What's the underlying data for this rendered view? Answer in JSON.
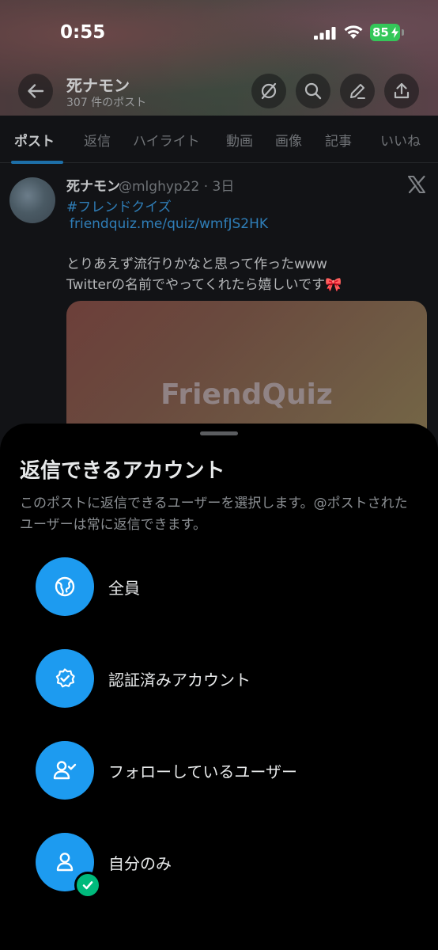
{
  "status": {
    "time": "0:55",
    "battery": "85"
  },
  "header": {
    "name": "死ナモン",
    "post_count": "307 件のポスト"
  },
  "tabs": [
    "ポスト",
    "返信",
    "ハイライト",
    "動画",
    "画像",
    "記事",
    "いいね"
  ],
  "post": {
    "name": "死ナモン",
    "handle": "@mlghyp22 · 3日",
    "hashtag": "#フレンドクイズ",
    "link": "friendquiz.me/quiz/wmfJS2HK",
    "text_line1": "とりあえず流行りかなと思って作ったwww",
    "text_line2": "Twitterの名前でやってくれたら嬉しいです🎀",
    "card_title": "FriendQuiz"
  },
  "sheet": {
    "title": "返信できるアカウント",
    "description": "このポストに返信できるユーザーを選択します。@ポストされたユーザーは常に返信できます。",
    "options": [
      {
        "label": "全員",
        "icon": "globe-icon"
      },
      {
        "label": "認証済みアカウント",
        "icon": "verified-badge-icon"
      },
      {
        "label": "フォローしているユーザー",
        "icon": "person-check-icon"
      },
      {
        "label": "自分のみ",
        "icon": "person-icon",
        "selected": true
      }
    ]
  },
  "colors": {
    "accent": "#1d9bf0",
    "selected_check": "#00ba7c",
    "battery": "#34c759"
  }
}
